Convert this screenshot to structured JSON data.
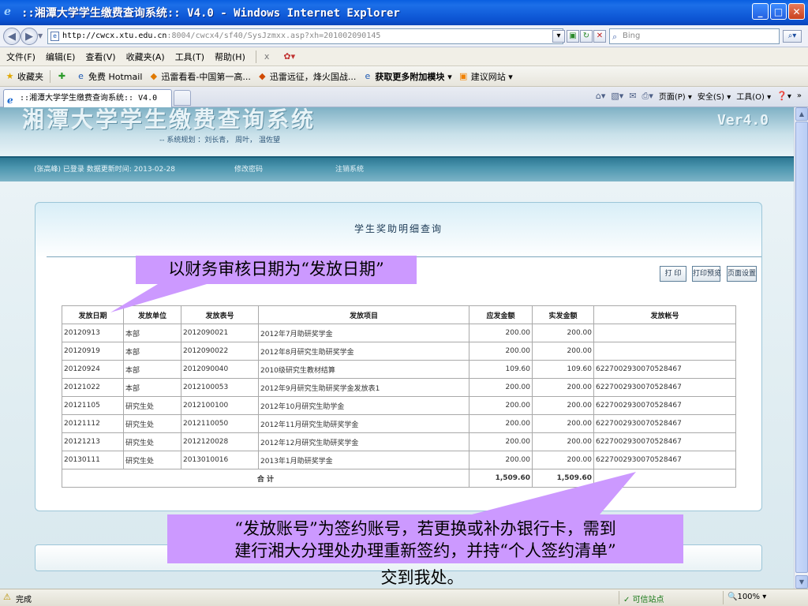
{
  "window": {
    "title": "::湘潭大学学生缴费查询系统:: V4.0 - Windows Internet Explorer",
    "minimize_glyph": "_",
    "maximize_glyph": "□",
    "close_glyph": "✕"
  },
  "address": {
    "url_host": "http://cwcx.xtu.edu.cn",
    "url_rest": ":8004/cwcx4/sf40/SysJzmxx.asp?xh=201002090145",
    "search_placeholder": "Bing"
  },
  "menu": {
    "items": [
      "文件(F)",
      "编辑(E)",
      "查看(V)",
      "收藏夹(A)",
      "工具(T)",
      "帮助(H)"
    ],
    "close_x": "x"
  },
  "favorites": {
    "label": "收藏夹",
    "items": [
      "免费 Hotmail",
      "迅雷看看-中国第一高...",
      "迅雷远征，烽火国战...",
      "获取更多附加模块 ▾",
      "建议网站 ▾"
    ]
  },
  "tabs": {
    "active_label": "::湘潭大学学生缴费查询系统:: V4.0"
  },
  "command_bar": {
    "page": "页面(P) ▾",
    "safety": "安全(S) ▾",
    "tools": "工具(O) ▾",
    "help": "▾",
    "more": "»"
  },
  "banner": {
    "title": "湘潭大学学生缴费查询系统",
    "credit": "-- 系统规划 ：刘长青， 周叶， 温佐望",
    "version": "Ver4.0"
  },
  "status_line": {
    "login": "(张高峰) 已登录  数据更新时间: 2013-02-28",
    "change_password": "修改密码",
    "logout": "注销系统"
  },
  "panel": {
    "title": "学生奖助明细查询",
    "print": "打 印",
    "print_preview": "打印预览",
    "page_setup": "页面设置"
  },
  "table": {
    "headers": [
      "发放日期",
      "发放单位",
      "发放表号",
      "发放项目",
      "应发金额",
      "实发金额",
      "发放帐号"
    ],
    "rows": [
      [
        "20120913",
        "本部",
        "2012090021",
        "2012年7月助研奖学金",
        "200.00",
        "200.00",
        ""
      ],
      [
        "20120919",
        "本部",
        "2012090022",
        "2012年8月研究生助研奖学金",
        "200.00",
        "200.00",
        ""
      ],
      [
        "20120924",
        "本部",
        "2012090040",
        "2010级研究生教材结算",
        "109.60",
        "109.60",
        "6227002930070528467"
      ],
      [
        "20121022",
        "本部",
        "2012100053",
        "2012年9月研究生助研奖学金发放表1",
        "200.00",
        "200.00",
        "6227002930070528467"
      ],
      [
        "20121105",
        "研究生处",
        "2012100100",
        "2012年10月研究生助学金",
        "200.00",
        "200.00",
        "6227002930070528467"
      ],
      [
        "20121112",
        "研究生处",
        "2012110050",
        "2012年11月研究生助研奖学金",
        "200.00",
        "200.00",
        "6227002930070528467"
      ],
      [
        "20121213",
        "研究生处",
        "2012120028",
        "2012年12月研究生助研奖学金",
        "200.00",
        "200.00",
        "6227002930070528467"
      ],
      [
        "20130111",
        "研究生处",
        "2013010016",
        "2013年1月助研奖学金",
        "200.00",
        "200.00",
        "6227002930070528467"
      ]
    ],
    "total_label": "合 计",
    "total_due": "1,509.60",
    "total_paid": "1,509.60"
  },
  "annotations": {
    "date_note": "以财务审核日期为“发放日期”",
    "account_note_line1": "“发放账号”为签约账号，若更换或补办银行卡，需到",
    "account_note_line2": "建行湘大分理处办理重新签约，并持“个人签约清单”",
    "account_note_line3": "交到我处。",
    "color": "#cc99ff"
  },
  "ie_status": {
    "done": "完成",
    "zone": "✓ 可信站点",
    "zoom": "🔍100% ▾"
  }
}
